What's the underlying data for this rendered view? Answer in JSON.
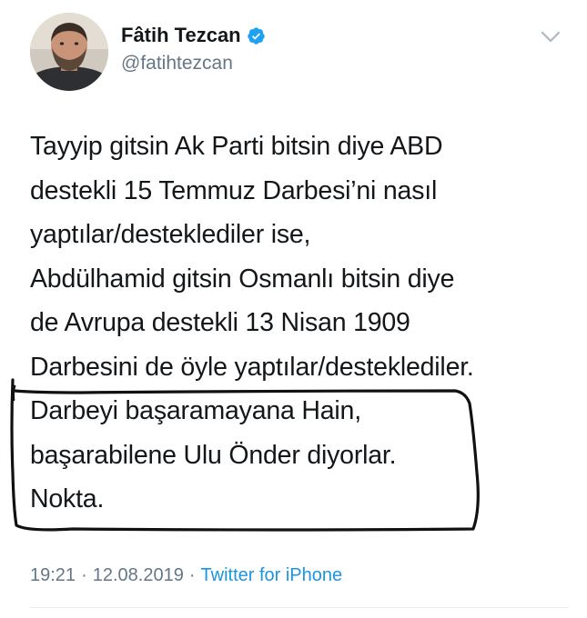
{
  "author": {
    "display_name": "Fâtih Tezcan",
    "username": "@fatihtezcan",
    "verified": true
  },
  "icons": {
    "verified": "verified-badge-icon",
    "menu": "chevron-down-icon"
  },
  "tweet": {
    "lines": [
      "Tayyip gitsin Ak Parti bitsin diye ABD",
      "destekli 15 Temmuz Darbesi’ni nasıl",
      "yaptılar/desteklediler ise,",
      "Abdülhamid gitsin Osmanlı bitsin diye",
      "de Avrupa destekli 13 Nisan 1909",
      "Darbesini de öyle yaptılar/desteklediler.",
      "Darbeyi başaramayana Hain,",
      "başarabilene Ulu Önder diyorlar.",
      "Nokta."
    ]
  },
  "meta": {
    "time": "19:21",
    "date": "12.08.2019",
    "separator": "·",
    "source": "Twitter for iPhone"
  },
  "colors": {
    "text": "#14171a",
    "secondary": "#657786",
    "link": "#1b95e0",
    "verified": "#1da1f2",
    "annotation": "#111111"
  }
}
